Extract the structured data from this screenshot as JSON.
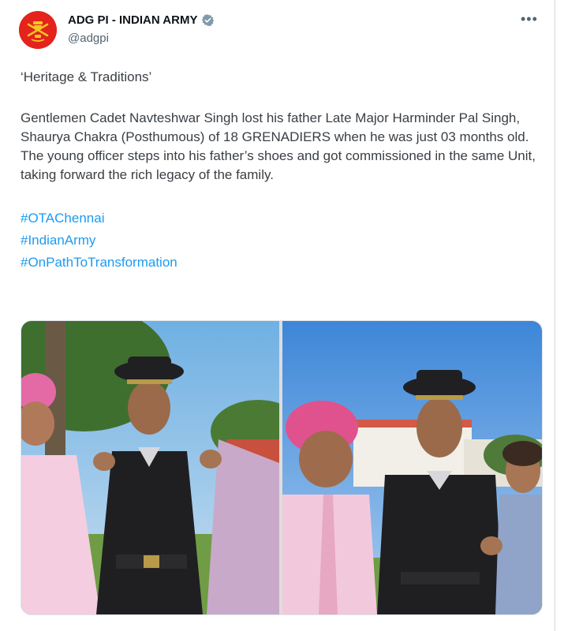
{
  "account": {
    "name": "ADG PI - INDIAN ARMY",
    "handle": "@adgpi"
  },
  "icons": {
    "avatar": "indian-army-emblem",
    "verified": "verified-badge-icon",
    "more": "more-options-icon"
  },
  "tweet": {
    "title": "‘Heritage & Traditions’",
    "paragraph": "Gentlemen Cadet Navteshwar Singh lost his father Late Major Harminder Pal Singh, Shaurya Chakra (Posthumous) of 18 GRENADIERS when he was just 03 months old. The young officer steps into his father’s shoes and got commissioned in the same Unit, taking forward the rich legacy of the family.",
    "hashtags": [
      "#OTAChennai",
      "#IndianArmy",
      "#OnPathToTransformation"
    ]
  },
  "colors": {
    "link": "#1d9bf0",
    "avatar_bg": "#e3231c",
    "verified": "#829aab"
  }
}
